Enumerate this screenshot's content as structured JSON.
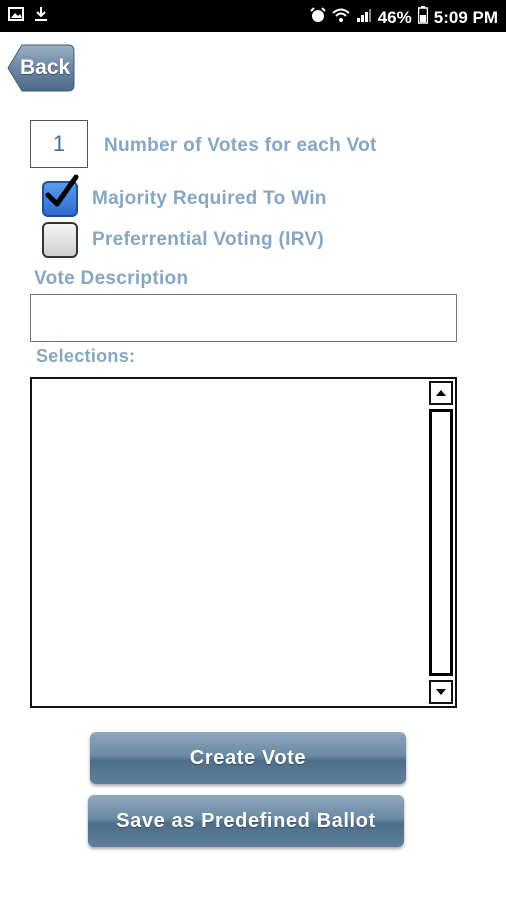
{
  "status_bar": {
    "battery": "46%",
    "time": "5:09 PM"
  },
  "header": {
    "back_label": "Back"
  },
  "form": {
    "votes_count_value": "1",
    "votes_count_label": "Number of Votes for each Vot",
    "majority_label": "Majority Required To Win",
    "majority_checked": true,
    "irv_label": "Preferrential Voting (IRV)",
    "irv_checked": false,
    "description_label": "Vote Description",
    "description_value": "",
    "selections_label": "Selections:"
  },
  "actions": {
    "create_label": "Create Vote",
    "save_label": "Save as Predefined Ballot"
  },
  "colors": {
    "label_color": "#86a6c2",
    "button_gradient_top": "#8ea7bd",
    "button_gradient_bottom": "#4f6e89"
  }
}
